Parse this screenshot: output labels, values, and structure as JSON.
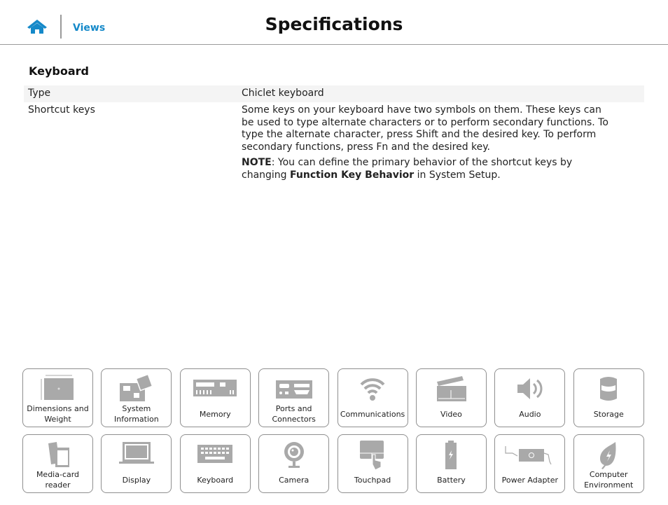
{
  "header": {
    "home_icon": "home-icon",
    "breadcrumb": "Views",
    "title": "Specifications"
  },
  "section_title": "Keyboard",
  "specs": [
    {
      "label": "Type",
      "value": "Chiclet keyboard"
    },
    {
      "label": "Shortcut keys",
      "paragraph": "Some keys on your keyboard have two symbols on them. These keys can be used to type alternate characters or to perform secondary functions. To type the alternate character, press Shift and the desired key. To perform secondary functions, press Fn and the desired key.",
      "note_label": "NOTE",
      "note_text": ": You can define the primary behavior of the shortcut keys by changing ",
      "note_bold": "Function Key Behavior",
      "note_end": " in System Setup."
    }
  ],
  "colors": {
    "accent": "#1589c9",
    "icon_gray": "#a9a9a9",
    "border": "#8f8f8f"
  },
  "tiles": [
    {
      "label": "Dimensions and Weight",
      "icon": "laptop-dimensions-icon"
    },
    {
      "label": "System Information",
      "icon": "motherboard-icon"
    },
    {
      "label": "Memory",
      "icon": "memory-module-icon"
    },
    {
      "label": "Ports and Connectors",
      "icon": "ports-icon"
    },
    {
      "label": "Communications",
      "icon": "wifi-icon"
    },
    {
      "label": "Video",
      "icon": "clapperboard-icon"
    },
    {
      "label": "Audio",
      "icon": "speaker-icon"
    },
    {
      "label": "Storage",
      "icon": "storage-drum-icon"
    },
    {
      "label": "Media-card reader",
      "icon": "media-card-icon"
    },
    {
      "label": "Display",
      "icon": "laptop-display-icon"
    },
    {
      "label": "Keyboard",
      "icon": "keyboard-icon"
    },
    {
      "label": "Camera",
      "icon": "webcam-icon"
    },
    {
      "label": "Touchpad",
      "icon": "touchpad-icon"
    },
    {
      "label": "Battery",
      "icon": "battery-icon"
    },
    {
      "label": "Power Adapter",
      "icon": "power-adapter-icon"
    },
    {
      "label": "Computer Environment",
      "icon": "leaf-icon"
    }
  ]
}
